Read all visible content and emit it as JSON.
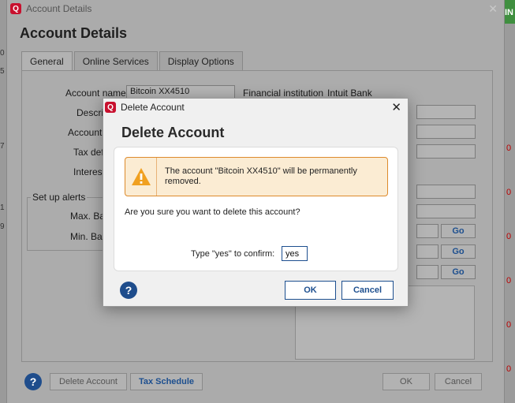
{
  "main_window": {
    "title": "Account Details",
    "heading": "Account Details",
    "tabs": [
      {
        "label": "General"
      },
      {
        "label": "Online Services"
      },
      {
        "label": "Display Options"
      }
    ],
    "fields": {
      "account_name_label": "Account name",
      "account_name_value": "Bitcoin XX4510",
      "description_label": "Descrip",
      "account_type_label": "Account",
      "tax_deferred_label": "Tax defe",
      "interest_label": "Interest",
      "financial_institution_label": "Financial institution",
      "financial_institution_value": "Intuit Bank"
    },
    "alerts": {
      "legend": "Set up alerts",
      "max_balance_label": "Max. Bal",
      "min_balance_label": "Min. Bal"
    },
    "go_buttons": [
      "Go",
      "Go",
      "Go"
    ],
    "bottom": {
      "help": "?",
      "delete_account": "Delete Account",
      "tax_schedule": "Tax Schedule",
      "ok": "OK",
      "cancel": "Cancel"
    }
  },
  "dialog": {
    "title": "Delete Account",
    "heading": "Delete Account",
    "warning": "The account \"Bitcoin XX4510\" will be permanently removed.",
    "question": "Are you sure you want to delete this account?",
    "confirm_label": "Type \"yes\" to confirm:",
    "confirm_value": "yes",
    "help": "?",
    "ok_label": "OK",
    "cancel_label": "Cancel"
  },
  "app_icon_letter": "Q",
  "colors": {
    "brand_red": "#c8102e",
    "accent_blue": "#1d4f8f",
    "warning_bg": "#fbecd3",
    "warning_border": "#dd8a2c",
    "warning_icon": "#f0a020"
  }
}
